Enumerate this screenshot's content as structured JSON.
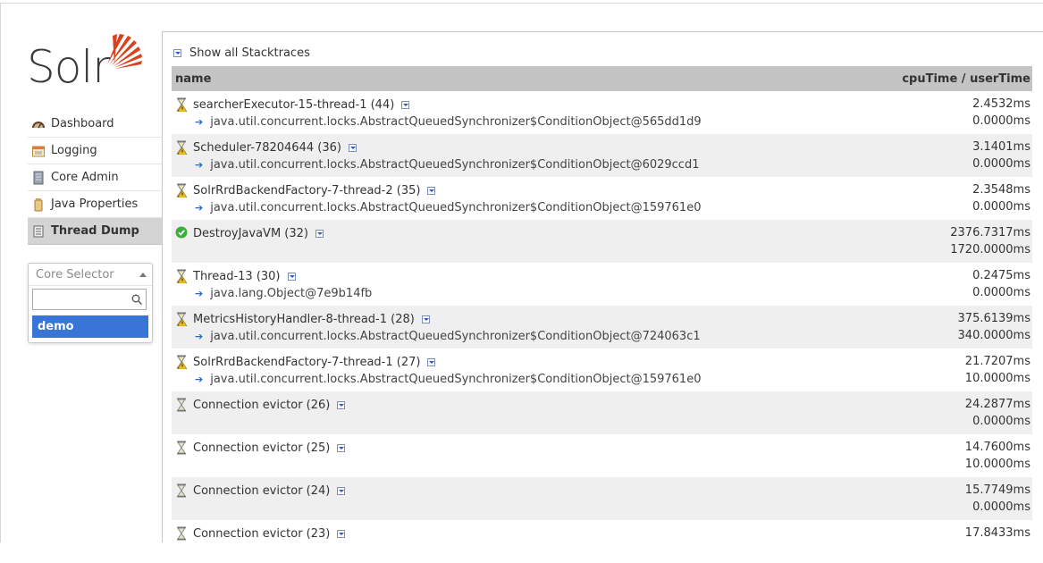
{
  "logo": {
    "text": "Solr"
  },
  "sidebar": {
    "items": [
      {
        "label": "Dashboard",
        "icon": "dashboard-icon"
      },
      {
        "label": "Logging",
        "icon": "logging-icon"
      },
      {
        "label": "Core Admin",
        "icon": "core-admin-icon"
      },
      {
        "label": "Java Properties",
        "icon": "java-properties-icon"
      },
      {
        "label": "Thread Dump",
        "icon": "thread-dump-icon",
        "active": true
      }
    ],
    "core_selector": {
      "placeholder": "Core Selector",
      "search_value": "",
      "options": [
        "demo"
      ]
    }
  },
  "main": {
    "show_all_label": "Show all Stacktraces",
    "columns": {
      "name": "name",
      "times": "cpuTime / userTime"
    },
    "threads": [
      {
        "name": "searcherExecutor-15-thread-1 (44)",
        "state": "waiting",
        "lock": "java.util.concurrent.locks.AbstractQueuedSynchronizer$ConditionObject@565dd1d9",
        "cpu": "2.4532ms",
        "user": "0.0000ms"
      },
      {
        "name": "Scheduler-78204644 (36)",
        "state": "waiting",
        "lock": "java.util.concurrent.locks.AbstractQueuedSynchronizer$ConditionObject@6029ccd1",
        "cpu": "3.1401ms",
        "user": "0.0000ms"
      },
      {
        "name": "SolrRrdBackendFactory-7-thread-2 (35)",
        "state": "waiting",
        "lock": "java.util.concurrent.locks.AbstractQueuedSynchronizer$ConditionObject@159761e0",
        "cpu": "2.3548ms",
        "user": "0.0000ms"
      },
      {
        "name": "DestroyJavaVM (32)",
        "state": "runnable",
        "lock": "",
        "cpu": "2376.7317ms",
        "user": "1720.0000ms"
      },
      {
        "name": "Thread-13 (30)",
        "state": "waiting",
        "lock": "java.lang.Object@7e9b14fb",
        "cpu": "0.2475ms",
        "user": "0.0000ms"
      },
      {
        "name": "MetricsHistoryHandler-8-thread-1 (28)",
        "state": "waiting",
        "lock": "java.util.concurrent.locks.AbstractQueuedSynchronizer$ConditionObject@724063c1",
        "cpu": "375.6139ms",
        "user": "340.0000ms"
      },
      {
        "name": "SolrRrdBackendFactory-7-thread-1 (27)",
        "state": "waiting",
        "lock": "java.util.concurrent.locks.AbstractQueuedSynchronizer$ConditionObject@159761e0",
        "cpu": "21.7207ms",
        "user": "10.0000ms"
      },
      {
        "name": "Connection evictor (26)",
        "state": "timed-waiting",
        "lock": "",
        "cpu": "24.2877ms",
        "user": "0.0000ms"
      },
      {
        "name": "Connection evictor (25)",
        "state": "timed-waiting",
        "lock": "",
        "cpu": "14.7600ms",
        "user": "10.0000ms"
      },
      {
        "name": "Connection evictor (24)",
        "state": "timed-waiting",
        "lock": "",
        "cpu": "15.7749ms",
        "user": "0.0000ms"
      },
      {
        "name": "Connection evictor (23)",
        "state": "timed-waiting",
        "lock": "",
        "cpu": "17.8433ms",
        "user": ""
      }
    ]
  },
  "colors": {
    "accent": "#d9411e",
    "selection": "#3875d7",
    "header_bg": "#c4c4c4",
    "row_alt": "#efefef"
  }
}
